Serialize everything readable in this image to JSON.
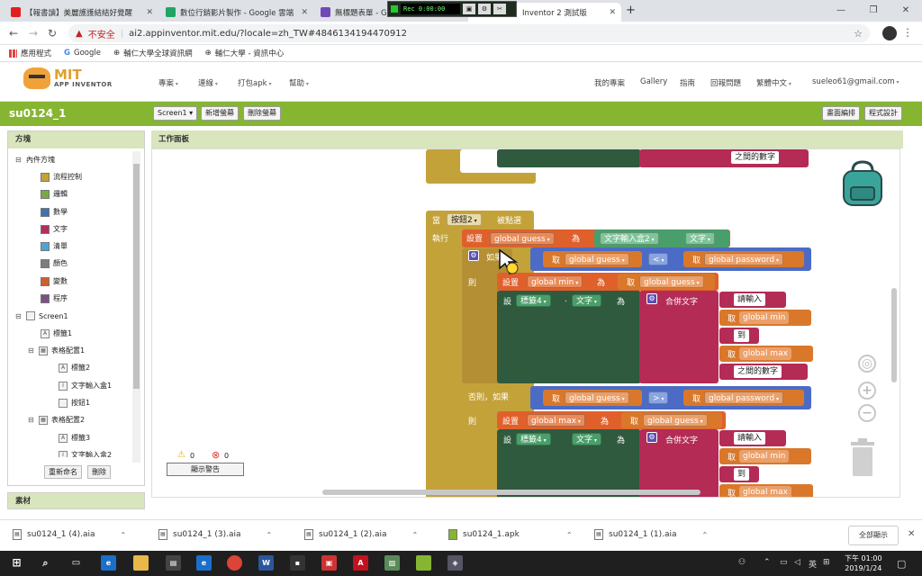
{
  "browser": {
    "tabs": [
      {
        "title": "【報書讀】美麗護護結結好覺醒",
        "favicon_color": "#e02020"
      },
      {
        "title": "數位行銷影片製作 - Google 雲端",
        "favicon_color": "#1fa463"
      },
      {
        "title": "無標題表單 - Go",
        "favicon_color": "#7248b9"
      },
      {
        "title": "Inventor 2 測試版",
        "favicon_color": "#86b532"
      }
    ],
    "recorder_label": "Rec 0:00:00",
    "address_warning": "不安全",
    "url": "ai2.appinventor.mit.edu/?locale=zh_TW#4846134194470912",
    "bookmarks": [
      "應用程式",
      "Google",
      "輔仁大學全球資訊網",
      "輔仁大學 - 資訊中心"
    ]
  },
  "appinventor": {
    "logo_mit": "MIT",
    "logo_sub": "APP INVENTOR",
    "menus": [
      "專案",
      "連線",
      "打包apk",
      "幫助"
    ],
    "right_links": [
      "我的專案",
      "Gallery",
      "指南",
      "回報問題",
      "繁體中文",
      "sueleo61@gmail.com"
    ],
    "project_name": "su0124_1",
    "screen_select": "Screen1",
    "add_screen": "新增螢幕",
    "remove_screen": "刪除螢幕",
    "designer_btn": "畫面編排",
    "blocks_btn": "程式設計"
  },
  "left_panel": {
    "title": "方塊",
    "builtin": "內件方塊",
    "categories": [
      {
        "label": "流程控制",
        "color": "#c4a23a"
      },
      {
        "label": "邏輯",
        "color": "#77ab41"
      },
      {
        "label": "數學",
        "color": "#3f71b5"
      },
      {
        "label": "文字",
        "color": "#b32d5e"
      },
      {
        "label": "清單",
        "color": "#49a6d4"
      },
      {
        "label": "顏色",
        "color": "#7d7d7d"
      },
      {
        "label": "變數",
        "color": "#d05f2d"
      },
      {
        "label": "程序",
        "color": "#7c5385"
      }
    ],
    "components": [
      "Screen1",
      "標籤1",
      "表格配置1",
      "標籤2",
      "文字輸入盒1",
      "按鈕1",
      "表格配置2",
      "標籤3",
      "文字輸入盒2"
    ],
    "rename_btn": "重新命名",
    "delete_btn": "刪除",
    "media_title": "素材"
  },
  "workspace": {
    "title": "工作面板",
    "warning_count": "0",
    "error_count": "0",
    "show_warnings": "顯示警告",
    "top_text": "之間的數字",
    "event_when": "當",
    "event_component": "按鈕2",
    "event_clicked": "被點選",
    "do_label": "執行",
    "set_label": "設置",
    "to_label": "為",
    "get_label": "取",
    "if_label": "如果",
    "then_label": "則",
    "elseif_label": "否則，如果",
    "set2_label": "設",
    "dot_label": ".",
    "var_guess": "global guess",
    "var_password": "global password",
    "var_min": "global min",
    "var_max": "global max",
    "textbox2": "文字輸入盒2",
    "text_prop": "文字",
    "label4": "標籤4",
    "op_lt": "<",
    "op_gt": ">",
    "join_label": "合併文字",
    "str_please": "請輸入",
    "str_to": "到",
    "str_between": "之間的數字"
  },
  "downloads": {
    "files": [
      "su0124_1 (4).aia",
      "su0124_1 (3).aia",
      "su0124_1 (2).aia",
      "su0124_1.apk",
      "su0124_1 (1).aia"
    ],
    "show_all": "全部顯示"
  },
  "taskbar": {
    "time": "下午 01:00",
    "date": "2019/1/24",
    "ime": "英"
  }
}
